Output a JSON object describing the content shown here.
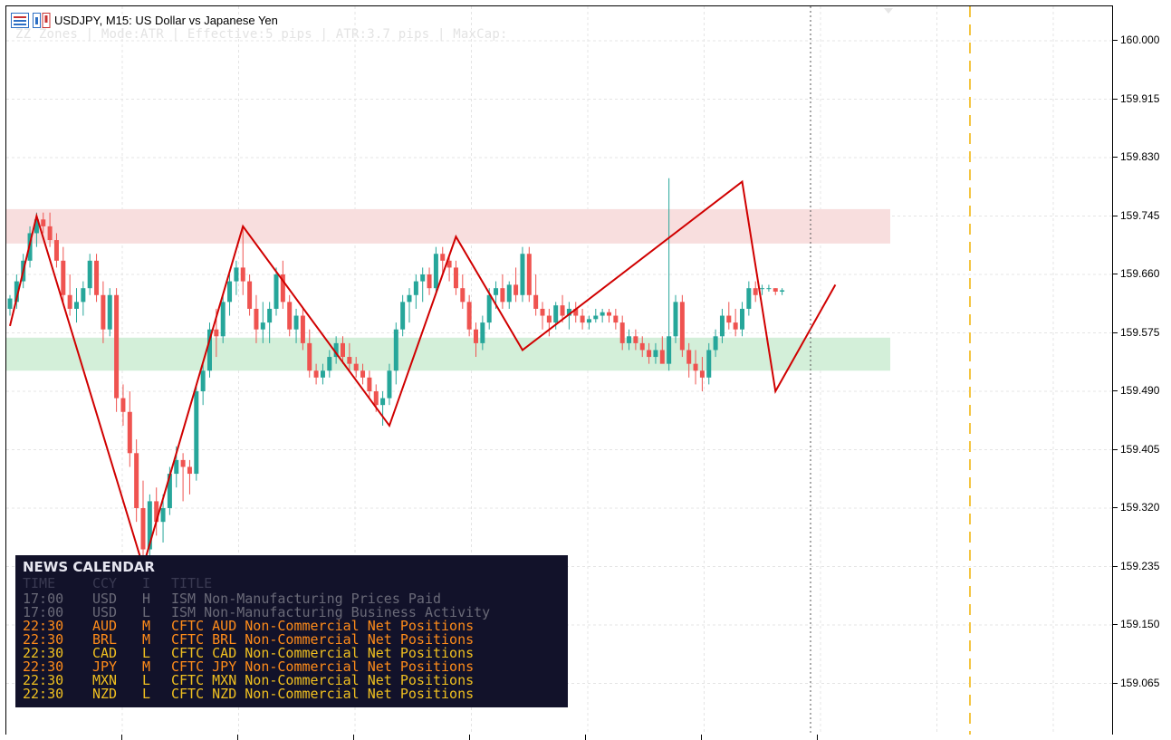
{
  "window": {
    "symbol_title": "USDJPY, M15:  US Dollar vs Japanese Yen",
    "indicator_info": "ZZ Zones | Mode:ATR | Effective:5 pips | ATR:3.7 pips | MaxCap:"
  },
  "icons": {
    "chart_type_icon": "bar-chart-icon",
    "indicator_icon": "indicator-icon"
  },
  "price_axis": {
    "labels": [
      "160.000",
      "159.915",
      "159.830",
      "159.745",
      "159.660",
      "159.575",
      "159.490",
      "159.405",
      "159.320",
      "159.235",
      "159.150",
      "159.065"
    ]
  },
  "colors": {
    "bull_candle": "#26a69a",
    "bear_candle": "#ef5350",
    "zigzag": "#d00000",
    "supply_zone": "#f8dede",
    "demand_zone": "#d3efd9",
    "future_line": "#f4c542",
    "news_bg": "#12122a",
    "high_impact_past": "#6a6a78",
    "medium_impact": "#ff8c1a",
    "low_impact": "#f0c020"
  },
  "chart_data": {
    "type": "candlestick",
    "symbol": "USDJPY",
    "timeframe": "M15",
    "ylim": [
      159.0,
      160.04
    ],
    "zones": [
      {
        "type": "supply",
        "from": 159.705,
        "to": 159.755
      },
      {
        "type": "demand",
        "from": 159.52,
        "to": 159.568
      }
    ],
    "zigzag_points": [
      [
        0,
        159.585
      ],
      [
        4,
        159.745
      ],
      [
        20,
        159.235
      ],
      [
        35,
        159.73
      ],
      [
        57,
        159.44
      ],
      [
        67,
        159.715
      ],
      [
        77,
        159.55
      ],
      [
        110,
        159.795
      ],
      [
        115,
        159.49
      ],
      [
        124,
        159.645
      ]
    ],
    "candles": [
      [
        159.61,
        159.63,
        159.6,
        159.625
      ],
      [
        159.62,
        159.66,
        159.61,
        159.65
      ],
      [
        159.65,
        159.69,
        159.64,
        159.68
      ],
      [
        159.68,
        159.73,
        159.67,
        159.72
      ],
      [
        159.72,
        159.75,
        159.7,
        159.74
      ],
      [
        159.74,
        159.75,
        159.72,
        159.73
      ],
      [
        159.73,
        159.75,
        159.7,
        159.71
      ],
      [
        159.71,
        159.72,
        159.67,
        159.68
      ],
      [
        159.68,
        159.7,
        159.62,
        159.63
      ],
      [
        159.63,
        159.66,
        159.6,
        159.61
      ],
      [
        159.61,
        159.64,
        159.59,
        159.62
      ],
      [
        159.62,
        159.65,
        159.6,
        159.64
      ],
      [
        159.64,
        159.69,
        159.63,
        159.68
      ],
      [
        159.68,
        159.69,
        159.62,
        159.63
      ],
      [
        159.63,
        159.65,
        159.56,
        159.58
      ],
      [
        159.58,
        159.64,
        159.57,
        159.63
      ],
      [
        159.63,
        159.64,
        159.46,
        159.48
      ],
      [
        159.48,
        159.5,
        159.44,
        159.46
      ],
      [
        159.46,
        159.49,
        159.38,
        159.4
      ],
      [
        159.4,
        159.42,
        159.3,
        159.32
      ],
      [
        159.32,
        159.36,
        159.24,
        159.26
      ],
      [
        159.26,
        159.34,
        159.25,
        159.33
      ],
      [
        159.33,
        159.35,
        159.28,
        159.3
      ],
      [
        159.3,
        159.34,
        159.27,
        159.32
      ],
      [
        159.32,
        159.38,
        159.31,
        159.37
      ],
      [
        159.37,
        159.41,
        159.35,
        159.39
      ],
      [
        159.39,
        159.4,
        159.33,
        159.38
      ],
      [
        159.38,
        159.39,
        159.34,
        159.37
      ],
      [
        159.37,
        159.5,
        159.36,
        159.49
      ],
      [
        159.49,
        159.53,
        159.47,
        159.52
      ],
      [
        159.52,
        159.59,
        159.51,
        159.58
      ],
      [
        159.58,
        159.61,
        159.54,
        159.57
      ],
      [
        159.57,
        159.63,
        159.56,
        159.62
      ],
      [
        159.62,
        159.66,
        159.6,
        159.65
      ],
      [
        159.65,
        159.68,
        159.63,
        159.67
      ],
      [
        159.67,
        159.73,
        159.63,
        159.65
      ],
      [
        159.65,
        159.66,
        159.6,
        159.61
      ],
      [
        159.61,
        159.63,
        159.56,
        159.58
      ],
      [
        159.58,
        159.62,
        159.56,
        159.59
      ],
      [
        159.59,
        159.62,
        159.56,
        159.61
      ],
      [
        159.61,
        159.67,
        159.6,
        159.66
      ],
      [
        159.66,
        159.68,
        159.61,
        159.62
      ],
      [
        159.62,
        159.63,
        159.57,
        159.58
      ],
      [
        159.58,
        159.61,
        159.56,
        159.6
      ],
      [
        159.6,
        159.61,
        159.55,
        159.56
      ],
      [
        159.56,
        159.58,
        159.51,
        159.52
      ],
      [
        159.52,
        159.53,
        159.5,
        159.51
      ],
      [
        159.51,
        159.53,
        159.5,
        159.52
      ],
      [
        159.52,
        159.55,
        159.51,
        159.54
      ],
      [
        159.54,
        159.57,
        159.53,
        159.56
      ],
      [
        159.56,
        159.57,
        159.53,
        159.54
      ],
      [
        159.54,
        159.56,
        159.52,
        159.53
      ],
      [
        159.53,
        159.54,
        159.51,
        159.52
      ],
      [
        159.52,
        159.53,
        159.5,
        159.51
      ],
      [
        159.51,
        159.52,
        159.48,
        159.49
      ],
      [
        159.49,
        159.5,
        159.46,
        159.47
      ],
      [
        159.47,
        159.49,
        159.44,
        159.48
      ],
      [
        159.48,
        159.53,
        159.47,
        159.52
      ],
      [
        159.52,
        159.59,
        159.5,
        159.58
      ],
      [
        159.58,
        159.63,
        159.57,
        159.62
      ],
      [
        159.62,
        159.64,
        159.59,
        159.63
      ],
      [
        159.63,
        159.66,
        159.61,
        159.65
      ],
      [
        159.65,
        159.67,
        159.62,
        159.66
      ],
      [
        159.66,
        159.67,
        159.63,
        159.64
      ],
      [
        159.64,
        159.7,
        159.63,
        159.69
      ],
      [
        159.69,
        159.7,
        159.66,
        159.68
      ],
      [
        159.68,
        159.69,
        159.65,
        159.67
      ],
      [
        159.67,
        159.68,
        159.63,
        159.64
      ],
      [
        159.64,
        159.66,
        159.61,
        159.62
      ],
      [
        159.62,
        159.63,
        159.57,
        159.58
      ],
      [
        159.58,
        159.59,
        159.54,
        159.56
      ],
      [
        159.56,
        159.6,
        159.55,
        159.59
      ],
      [
        159.59,
        159.64,
        159.58,
        159.63
      ],
      [
        159.63,
        159.65,
        159.61,
        159.64
      ],
      [
        159.64,
        159.66,
        159.61,
        159.62
      ],
      [
        159.62,
        159.65,
        159.61,
        159.645
      ],
      [
        159.645,
        159.67,
        159.62,
        159.63
      ],
      [
        159.63,
        159.7,
        159.62,
        159.69
      ],
      [
        159.69,
        159.7,
        159.62,
        159.63
      ],
      [
        159.63,
        159.66,
        159.6,
        159.61
      ],
      [
        159.61,
        159.62,
        159.58,
        159.6
      ],
      [
        159.6,
        159.61,
        159.57,
        159.59
      ],
      [
        159.59,
        159.62,
        159.58,
        159.615
      ],
      [
        159.615,
        159.63,
        159.59,
        159.6
      ],
      [
        159.6,
        159.62,
        159.58,
        159.61
      ],
      [
        159.61,
        159.62,
        159.59,
        159.6
      ],
      [
        159.6,
        159.61,
        159.58,
        159.59
      ],
      [
        159.59,
        159.6,
        159.58,
        159.595
      ],
      [
        159.595,
        159.61,
        159.59,
        159.6
      ],
      [
        159.6,
        159.61,
        159.59,
        159.605
      ],
      [
        159.605,
        159.61,
        159.59,
        159.6
      ],
      [
        159.6,
        159.61,
        159.58,
        159.59
      ],
      [
        159.59,
        159.6,
        159.55,
        159.56
      ],
      [
        159.56,
        159.58,
        159.55,
        159.57
      ],
      [
        159.57,
        159.58,
        159.55,
        159.56
      ],
      [
        159.56,
        159.57,
        159.54,
        159.55
      ],
      [
        159.55,
        159.56,
        159.53,
        159.54
      ],
      [
        159.54,
        159.56,
        159.53,
        159.55
      ],
      [
        159.55,
        159.57,
        159.54,
        159.53
      ],
      [
        159.53,
        159.8,
        159.52,
        159.57
      ],
      [
        159.57,
        159.63,
        159.56,
        159.62
      ],
      [
        159.62,
        159.63,
        159.54,
        159.55
      ],
      [
        159.55,
        159.56,
        159.51,
        159.53
      ],
      [
        159.53,
        159.55,
        159.5,
        159.52
      ],
      [
        159.52,
        159.54,
        159.49,
        159.51
      ],
      [
        159.51,
        159.56,
        159.5,
        159.55
      ],
      [
        159.55,
        159.58,
        159.54,
        159.57
      ],
      [
        159.57,
        159.61,
        159.56,
        159.6
      ],
      [
        159.6,
        159.62,
        159.58,
        159.59
      ],
      [
        159.59,
        159.61,
        159.57,
        159.58
      ],
      [
        159.58,
        159.62,
        159.57,
        159.61
      ],
      [
        159.61,
        159.65,
        159.6,
        159.64
      ],
      [
        159.64,
        159.65,
        159.62,
        159.63
      ],
      [
        159.64,
        159.645,
        159.63,
        159.64
      ],
      [
        159.64,
        159.645,
        159.635,
        159.64
      ],
      [
        159.64,
        159.64,
        159.63,
        159.635
      ],
      [
        159.635,
        159.64,
        159.63,
        159.637
      ]
    ]
  },
  "news_calendar": {
    "title": "NEWS CALENDAR",
    "headers": {
      "time": "TIME",
      "ccy": "CCY",
      "imp": "I",
      "title": "TITLE"
    },
    "rows": [
      {
        "time": "17:00",
        "ccy": "USD",
        "imp": "H",
        "title": "ISM Non-Manufacturing Prices Paid",
        "status": "past"
      },
      {
        "time": "17:00",
        "ccy": "USD",
        "imp": "L",
        "title": "ISM Non-Manufacturing Business Activity",
        "status": "past"
      },
      {
        "time": "22:30",
        "ccy": "AUD",
        "imp": "M",
        "title": "CFTC AUD Non-Commercial Net Positions",
        "status": "medium"
      },
      {
        "time": "22:30",
        "ccy": "BRL",
        "imp": "M",
        "title": "CFTC BRL Non-Commercial Net Positions",
        "status": "medium"
      },
      {
        "time": "22:30",
        "ccy": "CAD",
        "imp": "L",
        "title": "CFTC CAD Non-Commercial Net Positions",
        "status": "low"
      },
      {
        "time": "22:30",
        "ccy": "JPY",
        "imp": "M",
        "title": "CFTC JPY Non-Commercial Net Positions",
        "status": "medium"
      },
      {
        "time": "22:30",
        "ccy": "MXN",
        "imp": "L",
        "title": "CFTC MXN Non-Commercial Net Positions",
        "status": "low"
      },
      {
        "time": "22:30",
        "ccy": "NZD",
        "imp": "L",
        "title": "CFTC NZD Non-Commercial Net Positions",
        "status": "low"
      }
    ]
  }
}
